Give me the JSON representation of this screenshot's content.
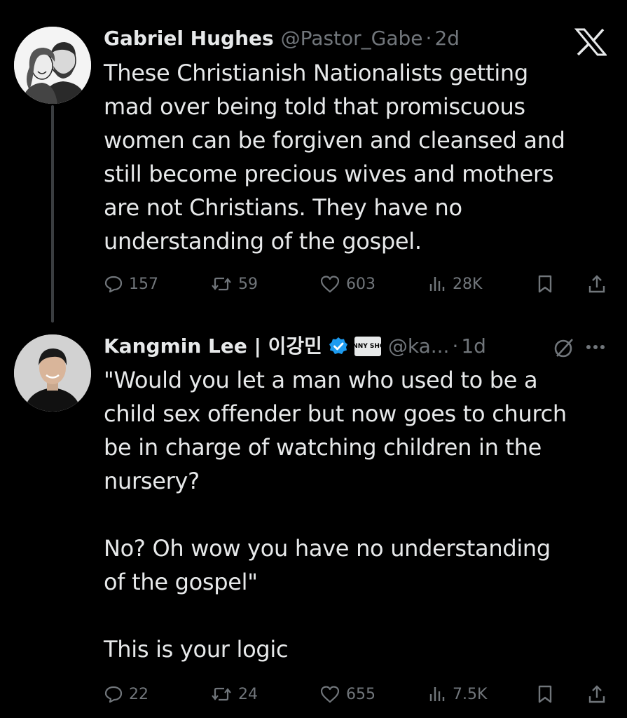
{
  "tweets": [
    {
      "author": "Gabriel Hughes",
      "handle": "@Pastor_Gabe",
      "separator": "·",
      "time": "2d",
      "text": "These Christianish Nationalists getting\nmad over being told that promiscuous\nwomen can be forgiven and cleansed and\nstill become precious wives and mothers\nare not Christians. They have no\nunderstanding of the gospel.",
      "stats": {
        "replies": "157",
        "reposts": "59",
        "likes": "603",
        "views": "28K"
      }
    },
    {
      "author": "Kangmin Lee | 이강민",
      "handle": "@ka...",
      "separator": "·",
      "time": "1d",
      "badge_text": "BENNY SHOW",
      "text": "\"Would you let a man who used to be a\nchild sex offender but now goes to church\nbe in charge of watching children in the\nnursery?\n\nNo? Oh wow you have no understanding\nof the gospel\"\n\nThis is your logic",
      "stats": {
        "replies": "22",
        "reposts": "24",
        "likes": "655",
        "views": "7.5K"
      }
    }
  ],
  "icons": {
    "brand": "x-logo-icon",
    "reply": "reply-icon",
    "repost": "repost-icon",
    "like": "heart-icon",
    "views": "views-icon",
    "bookmark": "bookmark-icon",
    "share": "share-icon",
    "verified": "verified-badge-icon",
    "grok": "grok-icon",
    "more": "more-icon"
  },
  "colors": {
    "background": "#000000",
    "text_primary": "#e7e9ea",
    "text_secondary": "#71767b",
    "verified": "#1d9bf0"
  }
}
